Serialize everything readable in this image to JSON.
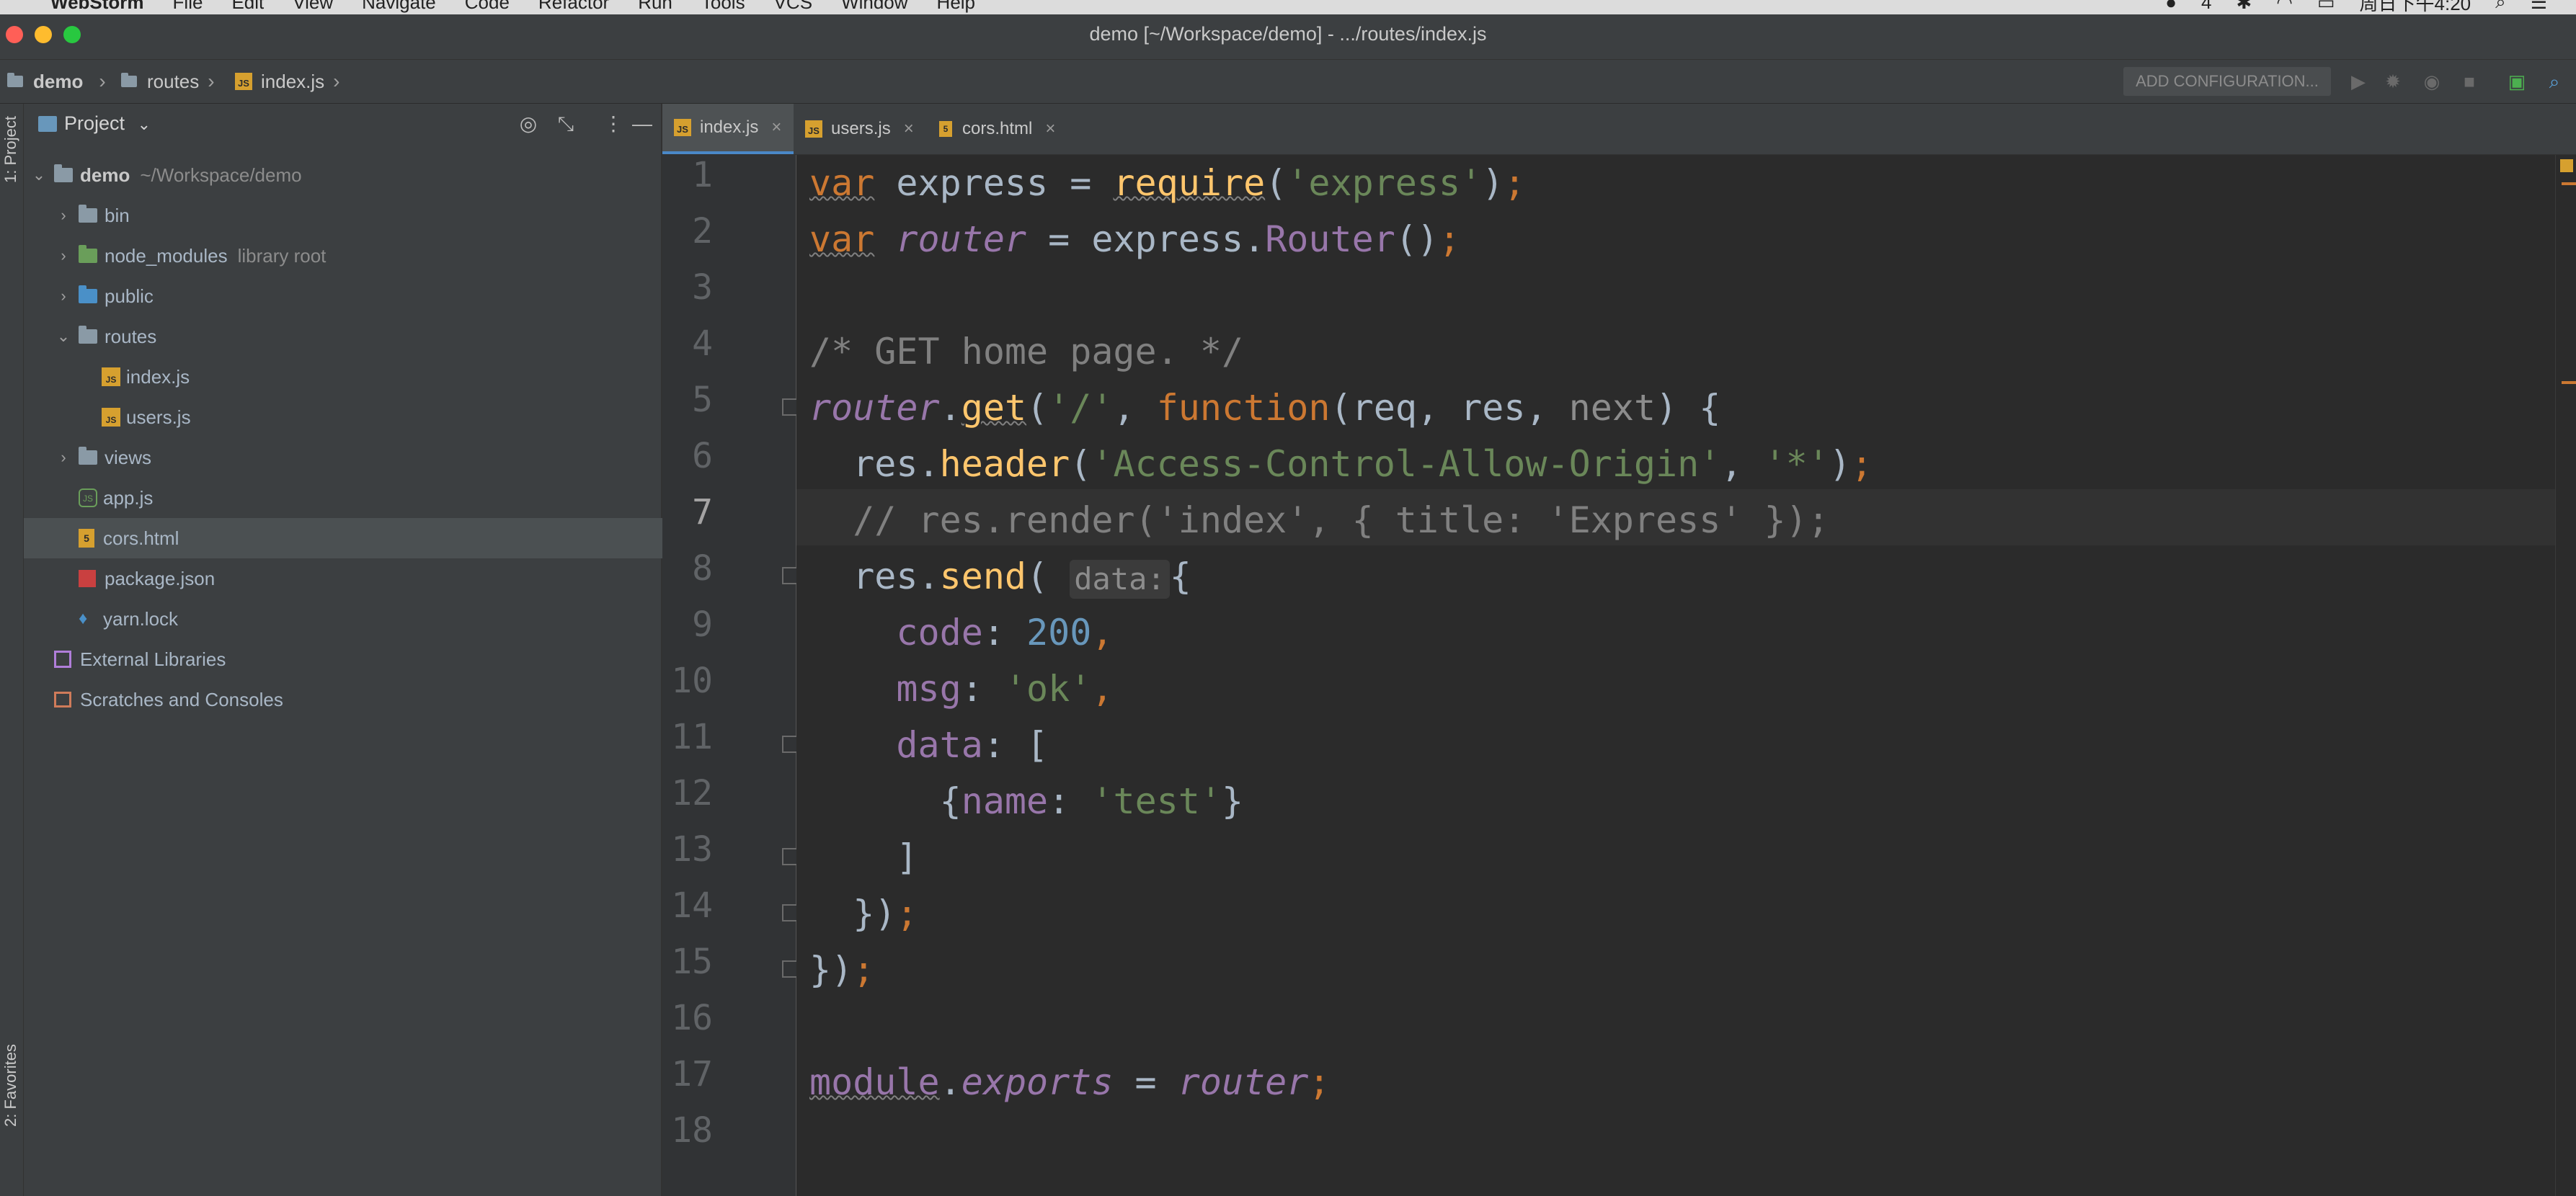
{
  "menubar": {
    "app_name": "WebStorm",
    "items": [
      "File",
      "Edit",
      "View",
      "Navigate",
      "Code",
      "Refactor",
      "Run",
      "Tools",
      "VCS",
      "Window",
      "Help"
    ],
    "status_count": "4",
    "clock": "周日下午4:20"
  },
  "window": {
    "title": "demo [~/Workspace/demo] - .../routes/index.js"
  },
  "navbar": {
    "breadcrumbs": [
      "demo",
      "routes",
      "index.js"
    ],
    "run_config": "ADD CONFIGURATION..."
  },
  "tool_strip": {
    "project_label": "1: Project",
    "favorites_label": "2: Favorites"
  },
  "project_panel": {
    "title": "Project",
    "tree": [
      {
        "name": "demo",
        "extra": "~/Workspace/demo"
      },
      {
        "name": "bin"
      },
      {
        "name": "node_modules",
        "extra": "library root"
      },
      {
        "name": "public"
      },
      {
        "name": "routes"
      },
      {
        "name": "index.js"
      },
      {
        "name": "users.js"
      },
      {
        "name": "views"
      },
      {
        "name": "app.js"
      },
      {
        "name": "cors.html"
      },
      {
        "name": "package.json"
      },
      {
        "name": "yarn.lock"
      },
      {
        "name": "External Libraries"
      },
      {
        "name": "Scratches and Consoles"
      }
    ]
  },
  "editor": {
    "tabs": [
      {
        "label": "index.js",
        "active": true
      },
      {
        "label": "users.js",
        "active": false
      },
      {
        "label": "cors.html",
        "active": false
      }
    ],
    "line_numbers": [
      "1",
      "2",
      "3",
      "4",
      "5",
      "6",
      "7",
      "8",
      "9",
      "10",
      "11",
      "12",
      "13",
      "14",
      "15",
      "16",
      "17",
      "18"
    ],
    "current_line": 7,
    "code_lines": [
      "var express = require('express');",
      "var router = express.Router();",
      "",
      "/* GET home page. */",
      "router.get('/', function(req, res, next) {",
      "  res.header('Access-Control-Allow-Origin', '*');",
      "  // res.render('index', { title: 'Express' });",
      "  res.send( data: {",
      "    code: 200,",
      "    msg: 'ok',",
      "    data: [",
      "      {name: 'test'}",
      "    ]",
      "  });",
      "});",
      "",
      "module.exports = router;",
      ""
    ],
    "param_hint": "data:"
  },
  "colors": {
    "keyword": "#cc7832",
    "string": "#6a8759",
    "number": "#6897bb",
    "function": "#ffc66d",
    "variable": "#9876aa",
    "comment": "#808080"
  }
}
